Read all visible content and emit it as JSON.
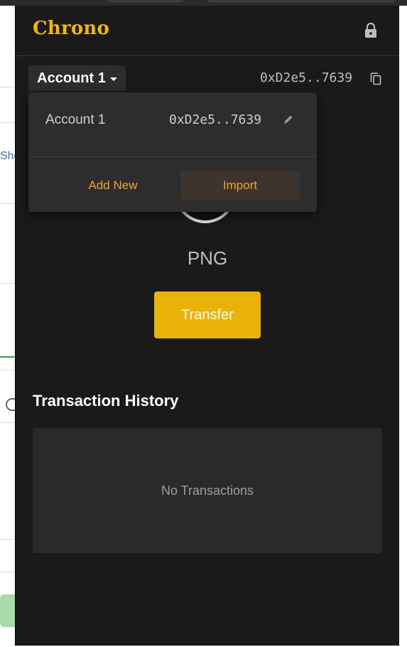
{
  "header": {
    "brand": "Chrono",
    "brand_color": "#f2b705",
    "lock_icon": "lock-icon"
  },
  "account": {
    "selector_label": "Account 1",
    "address_short": "0xD2e5..7639",
    "copy_icon": "copy-icon"
  },
  "dropdown": {
    "accounts": [
      {
        "name": "Account 1",
        "address": "0xD2e5..7639"
      }
    ],
    "add_new_label": "Add New",
    "import_label": "Import",
    "accent": "#f0a23a"
  },
  "token": {
    "symbol": "PNG"
  },
  "actions": {
    "transfer_label": "Transfer",
    "transfer_color": "#eab308"
  },
  "history": {
    "title": "Transaction History",
    "empty_text": "No Transactions"
  },
  "background_page": {
    "partial_text": "Sho"
  }
}
